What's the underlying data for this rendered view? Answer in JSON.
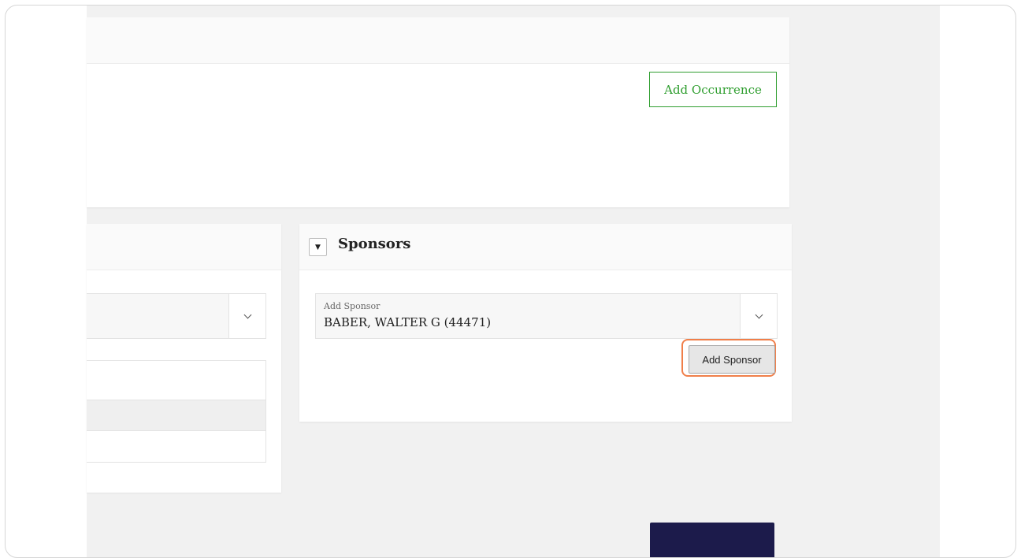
{
  "top_card": {
    "add_occurrence_label": "Add Occurrence"
  },
  "sponsors": {
    "title": "Sponsors",
    "toggle_glyph": "▼",
    "select_label": "Add Sponsor",
    "select_value": "BABER, WALTER G (44471)",
    "add_button_label": "Add Sponsor"
  },
  "colors": {
    "accent_green": "#2f9e2f",
    "highlight_orange": "#f07f4a",
    "navy_button": "#1c1b4b",
    "page_bg": "#f1f1f1"
  },
  "icons": {
    "collapse": "triangle-down-icon",
    "dropdown": "chevron-down-icon"
  }
}
